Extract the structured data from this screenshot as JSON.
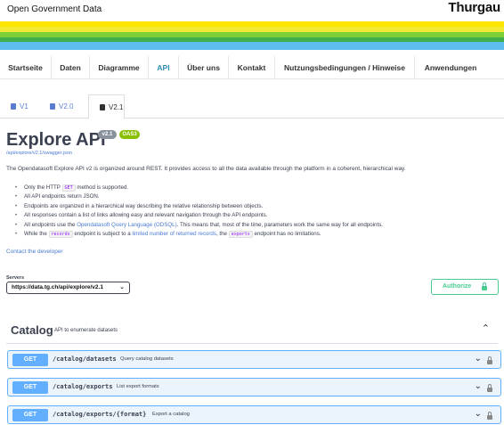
{
  "header": {
    "site_title": "Open Government Data",
    "brand": "Thurgau"
  },
  "stripe_colors": [
    "#ffe600",
    "#f6ec2b",
    "#7ed03a",
    "#42b04b",
    "#5ebcec"
  ],
  "nav": [
    {
      "label": "Startseite"
    },
    {
      "label": "Daten"
    },
    {
      "label": "Diagramme"
    },
    {
      "label": "API",
      "active": true
    },
    {
      "label": "Über uns"
    },
    {
      "label": "Kontakt"
    },
    {
      "label": "Nutzungsbedingungen / Hinweise"
    },
    {
      "label": "Anwendungen"
    }
  ],
  "version_tabs": [
    {
      "label": "V1"
    },
    {
      "label": "V2.0"
    },
    {
      "label": "V2.1",
      "active": true
    }
  ],
  "api": {
    "title": "Explore API",
    "version_badge": "v2.1",
    "oas_badge": "OAS3",
    "spec_url": "/api/explore/v2.1/swagger.json",
    "description": "The Opendatasoft Explore API v2 is organized around REST. It provides access to all the data available through the platform in a coherent, hierarchical way.",
    "bullets": {
      "b1_pre": "Only the HTTP",
      "b1_code": "GET",
      "b1_post": "method is supported.",
      "b2": "All API endpoints return JSON.",
      "b3": "Endpoints are organized in a hierarchical way describing the relative relationship between objects.",
      "b4": "All responses contain a list of links allowing easy and relevant navigation through the API endpoints.",
      "b5_pre": "All endpoints use the",
      "b5_link": "Opendatasoft Query Language (ODSQL)",
      "b5_post": ". This means that, most of the time, parameters work the same way for all endpoints.",
      "b6_pre": "While the",
      "b6_code1": "records",
      "b6_mid": "endpoint is subject to a",
      "b6_link": "limited number of returned records",
      "b6_mid2": ", the",
      "b6_code2": "exports",
      "b6_post": "endpoint has no limitations."
    },
    "contact": "Contact the developer"
  },
  "servers": {
    "label": "Servers",
    "selected": "https://data.tg.ch/api/explore/v2.1"
  },
  "authorize": {
    "label": "Authorize"
  },
  "catalog": {
    "title": "Catalog",
    "subtitle": "API to enumerate datasets",
    "operations": [
      {
        "method": "GET",
        "path": "/catalog/datasets",
        "summary": "Query catalog datasets"
      },
      {
        "method": "GET",
        "path": "/catalog/exports",
        "summary": "List export formats"
      },
      {
        "method": "GET",
        "path": "/catalog/exports/{format}",
        "summary": "Export a catalog"
      }
    ]
  }
}
